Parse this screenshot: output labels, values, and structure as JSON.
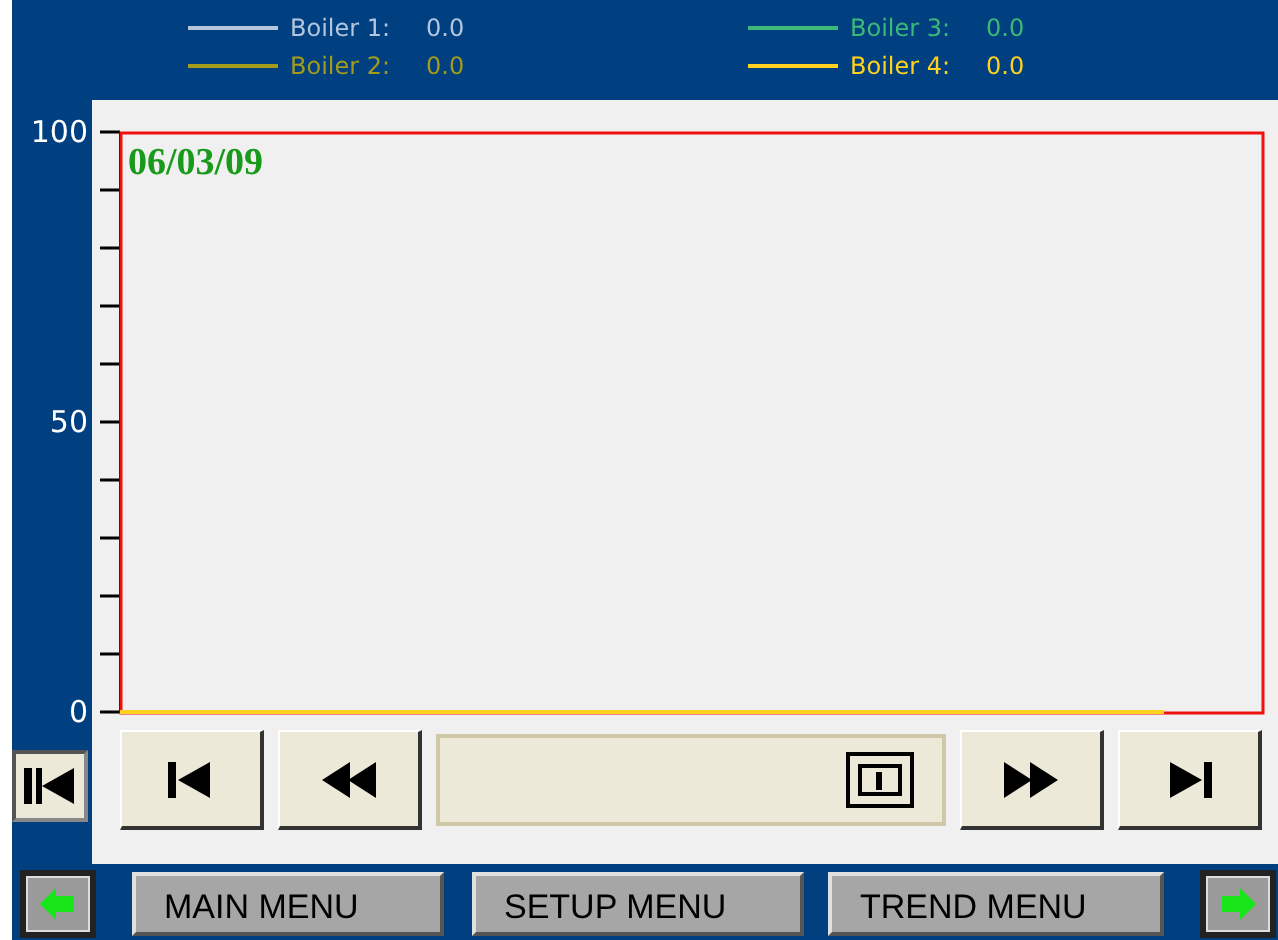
{
  "legend": [
    {
      "label": "Boiler 1:",
      "value": "0.0",
      "color": "#b4c6de"
    },
    {
      "label": "Boiler 2:",
      "value": "0.0",
      "color": "#a39b1a"
    },
    {
      "label": "Boiler 3:",
      "value": "0.0",
      "color": "#3cb878"
    },
    {
      "label": "Boiler 4:",
      "value": "0.0",
      "color": "#ffd21e"
    }
  ],
  "chart": {
    "date": "06/03/09",
    "axis_labels": [
      "100",
      "50",
      "0"
    ]
  },
  "menu_buttons": [
    "MAIN MENU",
    "SETUP MENU",
    "TREND MENU"
  ]
}
